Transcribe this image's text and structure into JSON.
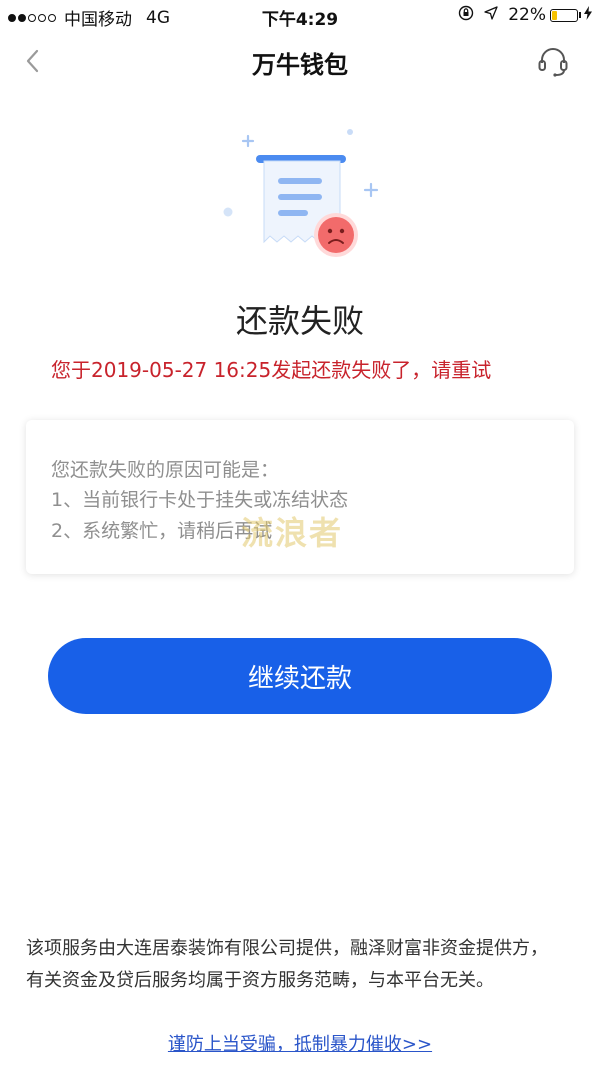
{
  "status_bar": {
    "carrier": "中国移动",
    "network": "4G",
    "time": "下午4:29",
    "battery_text": "22%",
    "battery_level": 0.22,
    "signal_strength": 2,
    "signal_total": 5,
    "icons": [
      "lock-rotation-icon",
      "location-arrow-icon",
      "battery-icon",
      "charging-bolt-icon"
    ]
  },
  "nav": {
    "back_icon": "chevron-left-icon",
    "title": "万牛钱包",
    "support_icon": "headset-icon"
  },
  "result": {
    "illustration_icon": "failed-receipt-sad-face-icon",
    "title": "还款失败",
    "message": "您于2019-05-27 16:25发起还款失败了，请重试",
    "message_color": "#c8232c"
  },
  "reasons": {
    "heading": "您还款失败的原因可能是：",
    "items": [
      "1、当前银行卡处于挂失或冻结状态",
      "2、系统繁忙，请稍后再试"
    ],
    "watermark": "流浪者"
  },
  "primary_button": {
    "label": "继续还款",
    "color": "#1860e8"
  },
  "footer": {
    "disclaimer_lines": [
      "该项服务由大连居泰装饰有限公司提供，融泽财富非资金提供方，",
      "有关资金及贷后服务均属于资方服务范畴，与本平台无关。"
    ],
    "fraud_link": "谨防上当受骗，抵制暴力催收>>",
    "link_color": "#2a55c9"
  }
}
